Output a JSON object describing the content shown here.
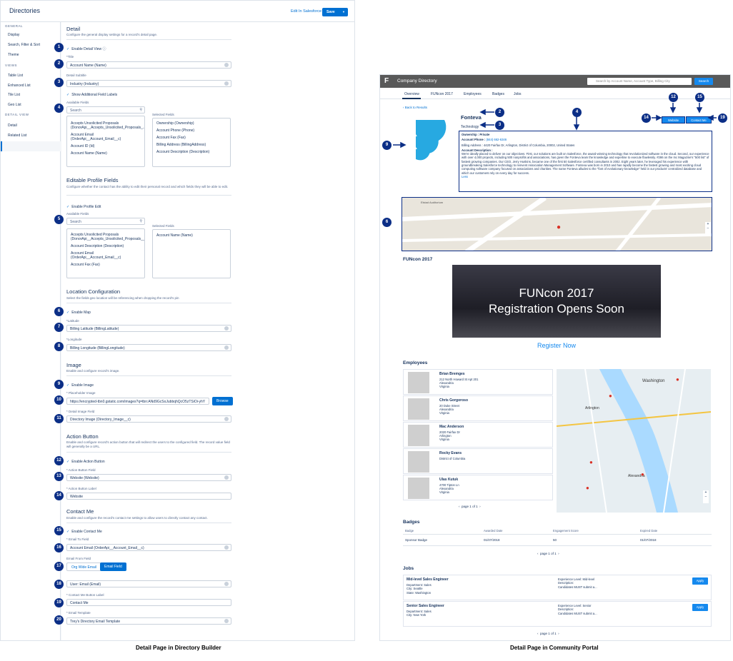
{
  "builder": {
    "title": "Directories",
    "edit_link": "Edit In Salesforce",
    "save": "Save",
    "sidebar": {
      "general_heading": "GENERAL",
      "general_items": [
        "Display",
        "Search, Filter & Sort",
        "Theme"
      ],
      "views_heading": "VIEWS",
      "views_items": [
        "Table List",
        "Enhanced List",
        "Tile List",
        "Geo List"
      ],
      "detail_heading": "DETAIL VIEW",
      "detail_items": [
        "Detail",
        "Related List"
      ]
    },
    "detail": {
      "title": "Detail",
      "desc": "Configure the general display settings for a record's detail page.",
      "enable": "Enable Detail View",
      "title_label": "*Title",
      "title_value": "Account Name (Name)",
      "subtitle_label": "Detail Subtitle",
      "subtitle_value": "Industry (Industry)",
      "show_additional": "Show Additional Field Labels",
      "available_label": "Available Fields",
      "search_placeholder": "Search",
      "selected_label": "Selected Fields",
      "available": [
        "Accepts Unsolicited Proposals (DonorApi__Accepts_Unsolicited_Proposals_...",
        "Account Email (OrderApi__Account_Email__c)",
        "Account ID (Id)",
        "Account Name (Name)"
      ],
      "selected": [
        "Ownership (Ownership)",
        "Account Phone (Phone)",
        "Account Fax (Fax)",
        "Billing Address (BillingAddress)",
        "Account Description (Description)"
      ]
    },
    "editable": {
      "title": "Editable Profile Fields",
      "desc": "Configure whether the contact has the ability to edit their personal record and which fields they will be able to edit.",
      "enable": "Enable Profile Edit",
      "available_label": "Available Fields",
      "search_placeholder": "Search",
      "selected_label": "Selected Fields",
      "available": [
        "Accepts Unsolicited Proposals (DonorApi__Accepts_Unsolicited_Proposals__c)",
        "Account Description (Description)",
        "Account Email (OrderApi__Account_Email__c)",
        "Account Fax (Fax)"
      ],
      "selected": [
        "Account Name (Name)"
      ]
    },
    "location": {
      "title": "Location Configuration",
      "desc": "Select the fields geo location will be referencing when dropping the record's pin",
      "enable": "Enable Map",
      "lat_label": "*Latitude",
      "lat_value": "Billing Latitude (BillingLatitude)",
      "lng_label": "*Longitude",
      "lng_value": "Billing Longitude (BillingLongitude)"
    },
    "image": {
      "title": "Image",
      "desc": "Enable and configure record's image.",
      "enable": "Enable Image",
      "placeholder_label": "* Placeholder Image",
      "placeholder_value": "https://encrypted-tbn0.gstatic.com/images?q=tbn:ANd9GcSoJubbqhQcO5zTSiOi-yhY",
      "browse": "Browse",
      "field_label": "* Detail Image Field",
      "field_value": "Directory Image (Directory_Image__c)"
    },
    "action": {
      "title": "Action Button",
      "desc": "Enable and configure record's action button that will redirect the users to the configured field. The record value field will generally be a URL.",
      "enable": "Enable Action Button",
      "field_label": "* Action Button Field",
      "field_value": "Website (Website)",
      "label_label": "* Action Button Label",
      "label_value": "Website"
    },
    "contact": {
      "title": "Contact Me",
      "desc": "Enable and configure the record's contact me settings to allow users to directly contact any contact.",
      "enable": "Enable Contact Me",
      "to_label": "* Email To Field",
      "to_value": "Account Email (OrderApi__Account_Email__c)",
      "from_label": "Email From Field",
      "from_opt1": "Org Wide Email",
      "from_opt2": "Email Field",
      "user_value": "User: Email (Email)",
      "btn_label_label": "* Contact Me Button Label",
      "btn_label_value": "Contact Me",
      "template_label": "* Email Template",
      "template_value": "Trey's Directory Email Template"
    },
    "markers": [
      "1",
      "2",
      "3",
      "4",
      "5",
      "6",
      "7",
      "8",
      "9",
      "10",
      "11",
      "12",
      "13",
      "14",
      "15",
      "16",
      "17",
      "18",
      "19",
      "20"
    ]
  },
  "portal": {
    "logo": "F",
    "title": "Company Directory",
    "search_placeholder": "Search by Account Name, Account Type, Billing City",
    "search_btn": "Search",
    "tabs": [
      "Overview",
      "FUNcon 2017",
      "Employees",
      "Badges",
      "Jobs"
    ],
    "back": "Back to Results",
    "name": "Fonteva",
    "industry": "Technology",
    "ownership": "Ownership : Private",
    "phone_label": "Account Phone :",
    "phone_value": "(844) 662-6346",
    "billing": "Billing Address : 4420 Fairfax Dr, Arlington, District of Columbia, 20002, United States",
    "desc_label": "Account Description :",
    "desc_text": "We're ideally placed to deliver on our objectives. First, our solutions are built on Salesforce, the award-winning technology that revolutionized software in the cloud. Second, our experience with over 4,000 projects, including 500 nonprofits and associations, has given the Fonteva team the knowledge and expertise to execute flawlessly. #286 on the Inc Magazine's \"500 list\" of fastest growing companies. Our CEO, Jerry Huskins, became one of the first 50 Salesforce certified consultants in 2002. Eight years later, he leveraged his experience with groundbreaking Salesforce technology to reinvent Association Management Software. Fonteva was born in 2010 and has rapidly become the fastest growing and most exciting cloud computing software company focused on associations and charities. The name Fonteva alludes to the \"font of evolutionary knowledge\" held in our products' centralized database and which our customers rely on every day for success.",
    "less": "Less",
    "website_btn": "Website",
    "contact_btn": "Contact Me",
    "map1_label": "Elstad Auditorium",
    "funcon_heading": "FUNcon 2017",
    "banner_line1": "FUNcon 2017",
    "banner_line2": "Registration Opens Soon",
    "register": "Register Now",
    "employees_heading": "Employees",
    "employees": [
      {
        "name": "Brian Bremges",
        "addr1": "212 North Howard St Apt 201",
        "addr2": "Alexandria",
        "addr3": "Virginia"
      },
      {
        "name": "Chris Gorgoroso",
        "addr1": "20 Duke Street",
        "addr2": "Alexandria",
        "addr3": "Virginia"
      },
      {
        "name": "Mac Anderson",
        "addr1": "2020 Fairfax Dr",
        "addr2": "Arlington",
        "addr3": "Virginia"
      },
      {
        "name": "Rocky Evans",
        "addr1": "District of Columbia",
        "addr2": "",
        "addr3": ""
      },
      {
        "name": "Ulas Kutuk",
        "addr1": "4700 Tipton Ln",
        "addr2": "Alexandria",
        "addr3": "Virginia"
      }
    ],
    "map2_labels": [
      "Washington",
      "Arlington",
      "Alexandria"
    ],
    "pager_page": "page",
    "pager_current": "1",
    "pager_of": "of",
    "pager_total": "1",
    "badges_heading": "Badges",
    "badge_cols": [
      "Badge",
      "Awarded Date",
      "Engagement Score",
      "Expired Date"
    ],
    "badge_row": [
      "Sponsor Badge",
      "01/07/2018",
      "50",
      "01/07/2018"
    ],
    "jobs_heading": "Jobs",
    "jobs": [
      {
        "title": "Mid-level Sales Engineer",
        "dept": "Department: Sales",
        "city": "City: Seattle",
        "state": "State: Washington",
        "level": "Experience Level: Mid-level",
        "desc_l": "Description:",
        "desc": "Candidates MUST submit a...",
        "apply": "Apply"
      },
      {
        "title": "Senior Sales Engineer",
        "dept": "Department: Sales",
        "city": "City: New York",
        "state": "",
        "level": "Experience Level: Senior",
        "desc_l": "Description:",
        "desc": "Candidates MUST submit a...",
        "apply": "Apply"
      }
    ]
  },
  "captions": {
    "left": "Detail Page in Directory Builder",
    "right": "Detail Page in Community Portal"
  },
  "colors": {
    "marker": "#0b2e86",
    "brand": "#0070d2",
    "portal_accent": "#1589ee"
  }
}
